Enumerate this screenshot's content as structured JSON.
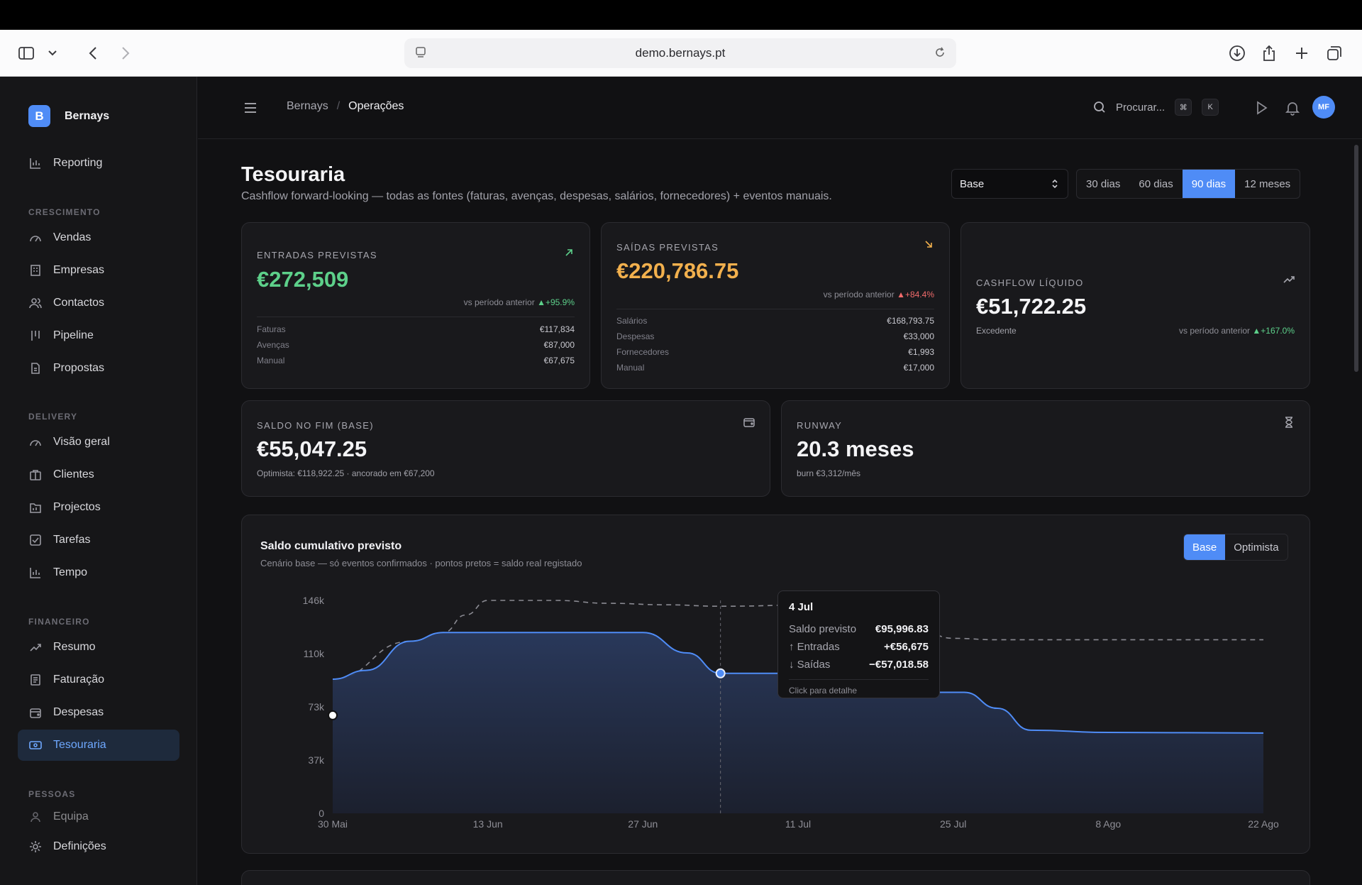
{
  "browser": {
    "url": "demo.bernays.pt"
  },
  "brand": {
    "letter": "B",
    "name": "Bernays"
  },
  "sidebar": {
    "top_item": "Reporting",
    "sections": [
      {
        "title": "CRESCIMENTO",
        "items": [
          "Vendas",
          "Empresas",
          "Contactos",
          "Pipeline",
          "Propostas"
        ]
      },
      {
        "title": "DELIVERY",
        "items": [
          "Visão geral",
          "Clientes",
          "Projectos",
          "Tarefas",
          "Tempo"
        ]
      },
      {
        "title": "FINANCEIRO",
        "items": [
          "Resumo",
          "Faturação",
          "Despesas",
          "Tesouraria"
        ]
      },
      {
        "title": "PESSOAS",
        "items": [
          "Equipa"
        ]
      }
    ],
    "active": "Tesouraria",
    "bottom_item": "Definições"
  },
  "header": {
    "breadcrumb": [
      "Bernays",
      "Operações"
    ],
    "search_label": "Procurar...",
    "kbd": [
      "⌘",
      "K"
    ],
    "avatar_initials": "MF"
  },
  "page": {
    "title": "Tesouraria",
    "subtitle": "Cashflow forward-looking — todas as fontes (faturas, avenças, despesas, salários, fornecedores) + eventos manuais.",
    "scenario_select": "Base",
    "periods": [
      "30 dias",
      "60 dias",
      "90 dias",
      "12 meses"
    ],
    "active_period": "90 dias"
  },
  "cards": {
    "entradas": {
      "label": "ENTRADAS PREVISTAS",
      "value": "€272,509",
      "vs_label": "vs período anterior",
      "vs_value": "▲+95.9%",
      "rows": [
        {
          "k": "Faturas",
          "v": "€117,834"
        },
        {
          "k": "Avenças",
          "v": "€87,000"
        },
        {
          "k": "Manual",
          "v": "€67,675"
        }
      ]
    },
    "saidas": {
      "label": "SAÍDAS PREVISTAS",
      "value": "€220,786.75",
      "vs_label": "vs período anterior",
      "vs_value": "▲+84.4%",
      "rows": [
        {
          "k": "Salários",
          "v": "€168,793.75"
        },
        {
          "k": "Despesas",
          "v": "€33,000"
        },
        {
          "k": "Fornecedores",
          "v": "€1,993"
        },
        {
          "k": "Manual",
          "v": "€17,000"
        }
      ]
    },
    "cashflow": {
      "label": "CASHFLOW LÍQUIDO",
      "value": "€51,722.25",
      "note": "Excedente",
      "vs_label": "vs período anterior",
      "vs_value": "▲+167.0%"
    },
    "saldo": {
      "label": "SALDO NO FIM (BASE)",
      "value": "€55,047.25",
      "note": "Optimista: €118,922.25 · ancorado em €67,200"
    },
    "runway": {
      "label": "RUNWAY",
      "value": "20.3 meses",
      "note": "burn €3,312/mês"
    }
  },
  "chart_card": {
    "title": "Saldo cumulativo previsto",
    "subtitle": "Cenário base — só eventos confirmados · pontos pretos = saldo real registado",
    "toggle": [
      "Base",
      "Optimista"
    ],
    "active_toggle": "Base",
    "tooltip": {
      "date": "4 Jul",
      "rows": [
        {
          "k": "Saldo previsto",
          "v": "€95,996.83",
          "color": "#f1f1f4"
        },
        {
          "k": "↑ Entradas",
          "v": "+€56,675",
          "color": "#5dd08a"
        },
        {
          "k": "↓ Saídas",
          "v": "−€57,018.58",
          "color": "#f2b04d"
        }
      ],
      "hint": "Click para detalhe"
    }
  },
  "chart_data": {
    "type": "area",
    "title": "Saldo cumulativo previsto",
    "x_ticks": [
      "30 Mai",
      "13 Jun",
      "27 Jun",
      "11 Jul",
      "25 Jul",
      "8 Ago",
      "22 Ago"
    ],
    "y_ticks": [
      "0",
      "37k",
      "73k",
      "110k",
      "146k"
    ],
    "ylim": [
      0,
      146000
    ],
    "xlim_days": [
      0,
      84
    ],
    "series": [
      {
        "name": "Base",
        "color": "#4f8cf6",
        "points": [
          [
            0,
            92000
          ],
          [
            3,
            98000
          ],
          [
            7,
            118000
          ],
          [
            10,
            124000
          ],
          [
            28,
            124000
          ],
          [
            32,
            110000
          ],
          [
            35,
            96000
          ],
          [
            41,
            96000
          ],
          [
            46,
            96000
          ],
          [
            52,
            83000
          ],
          [
            57,
            83000
          ],
          [
            60,
            72000
          ],
          [
            63,
            57000
          ],
          [
            70,
            55500
          ],
          [
            84,
            55047
          ]
        ]
      },
      {
        "name": "Optimista",
        "color": "#8a8a92",
        "points": [
          [
            0,
            92000
          ],
          [
            7,
            118000
          ],
          [
            10,
            124000
          ],
          [
            12,
            136000
          ],
          [
            14,
            146000
          ],
          [
            20,
            146000
          ],
          [
            25,
            144000
          ],
          [
            30,
            143000
          ],
          [
            35,
            142000
          ],
          [
            44,
            143000
          ],
          [
            47,
            137000
          ],
          [
            52,
            130000
          ],
          [
            56,
            120000
          ],
          [
            60,
            119000
          ],
          [
            84,
            119000
          ]
        ]
      }
    ],
    "actual_points": [
      [
        0,
        67200
      ]
    ],
    "highlight": {
      "x": 35,
      "y": 95997
    },
    "accent": "#4f8cf6"
  }
}
